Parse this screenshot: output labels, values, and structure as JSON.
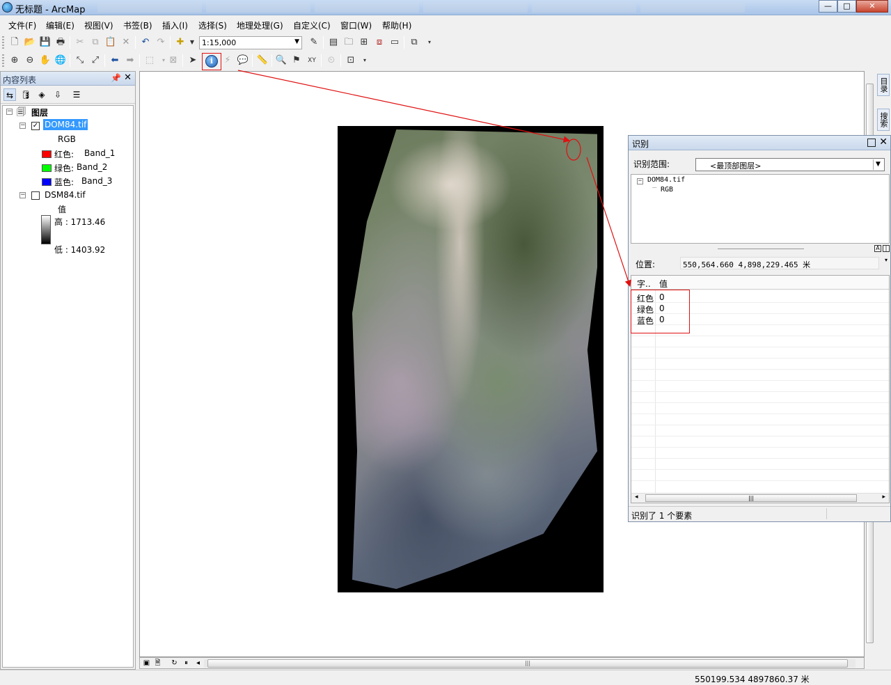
{
  "window": {
    "title": "无标题 - ArcMap",
    "buttons": {
      "minimize": "—",
      "maximize": "□",
      "close": "✕"
    }
  },
  "menu": [
    "文件(F)",
    "编辑(E)",
    "视图(V)",
    "书签(B)",
    "插入(I)",
    "选择(S)",
    "地理处理(G)",
    "自定义(C)",
    "窗口(W)",
    "帮助(H)"
  ],
  "toolbar": {
    "scale": "1:15,000"
  },
  "toc": {
    "title": "内容列表",
    "root_layer": "图层",
    "layers": [
      {
        "name": "DOM84.tif",
        "checked": true,
        "subtitle": "RGB",
        "bands": [
          {
            "label": "红色:",
            "band": "Band_1",
            "color": "#ff0000"
          },
          {
            "label": "绿色:",
            "band": "Band_2",
            "color": "#00ff00"
          },
          {
            "label": "蓝色:",
            "band": "Band_3",
            "color": "#0000ff"
          }
        ]
      },
      {
        "name": "DSM84.tif",
        "checked": false,
        "value_label": "值",
        "high": "高 : 1713.46",
        "low": "低 : 1403.92"
      }
    ]
  },
  "identify": {
    "title": "识别",
    "range_label": "识别范围:",
    "range_value": "<最顶部图层>",
    "tree_root": "DOM84.tif",
    "tree_child": "RGB",
    "position_label": "位置:",
    "position_value": "550,564.660  4,898,229.465 米",
    "col_field": "字..",
    "col_value": "值",
    "rows": [
      {
        "field": "红色",
        "value": "0"
      },
      {
        "field": "绿色",
        "value": "0"
      },
      {
        "field": "蓝色",
        "value": "0"
      }
    ],
    "status": "识别了 1 个要素"
  },
  "right_dock": [
    "目录",
    "搜索"
  ],
  "status": {
    "coordinates": "550199.534  4897860.37 米"
  },
  "colors": {
    "annotation_red": "#e01010",
    "selection_blue": "#3399ff"
  }
}
